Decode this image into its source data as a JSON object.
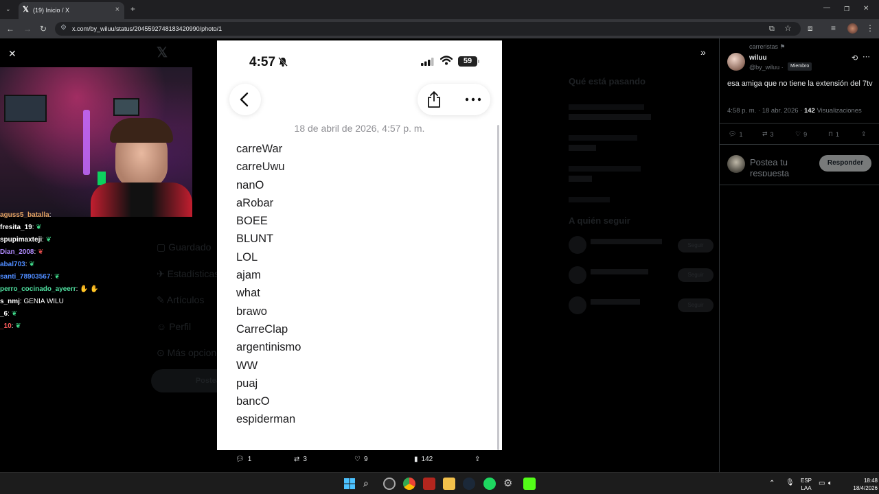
{
  "browser": {
    "tab_title": "(19) Inicio / X",
    "url": "x.com/by_wiluu/status/2045592748183420990/photo/1",
    "minimize": "—",
    "restore": "❐",
    "close": "✕"
  },
  "photo": {
    "status_time": "4:57",
    "battery": "59",
    "note_date": "18 de abril de 2026, 4:57 p. m.",
    "note_lines": [
      "carreWar",
      "carreUwu",
      "nanO",
      "aRobar",
      "BOEE",
      "BLUNT",
      "LOL",
      "ajam",
      "what",
      "brawo",
      "CarreClap",
      "argentinismo",
      "WW",
      "puaj",
      "bancO",
      "espiderman"
    ]
  },
  "viewer_actions": {
    "replies": "1",
    "reposts": "3",
    "likes": "9",
    "views": "142"
  },
  "tweet": {
    "community": "carreristas",
    "author_name": "wiluu",
    "author_handle": "@by_wiluu",
    "separator": "·",
    "member_badge": "Miembro",
    "text": "esa amiga que no tiene la extensión del 7tv",
    "time": "4:58 p. m.",
    "date": "18 abr. 2026",
    "views_count": "142",
    "views_label": "Visualizaciones",
    "stats": {
      "replies": "1",
      "reposts": "3",
      "likes": "9",
      "bookmarks": "1"
    },
    "reply_placeholder": "Postea tu respuesta",
    "reply_button": "Responder"
  },
  "chat": [
    {
      "user": "aguss5_batalla",
      "text": "",
      "color": "#e0a060"
    },
    {
      "user": "fresita_19",
      "text": "",
      "color": "#ffffff"
    },
    {
      "user": "spupimaxteji",
      "text": "",
      "color": "#ffffff"
    },
    {
      "user": "Dian_2008",
      "text": "",
      "color": "#b28cff"
    },
    {
      "user": "abal703",
      "text": "",
      "color": "#4f8cff"
    },
    {
      "user": "santi_78903567",
      "text": "",
      "color": "#4f8cff"
    },
    {
      "user": "perro_cocinado_ayeerr",
      "text": "",
      "color": "#4fe0a0"
    },
    {
      "user": "s_nmj",
      "text": "GENIA WILU",
      "color": "#ffffff"
    },
    {
      "user": "_6",
      "text": "",
      "color": "#ffffff"
    },
    {
      "user": "_10",
      "text": "",
      "color": "#ff5c5c"
    }
  ],
  "taskbar": {
    "language": "ESP",
    "layout": "LAA",
    "time": "18:48",
    "date": "18/4/2026"
  },
  "background_page": {
    "trends_title": "Qué está pasando",
    "follow_title": "A quién seguir",
    "nav_items": [
      "Guardado",
      "Estadísticas",
      "Artículos",
      "Perfil",
      "Más opciones"
    ],
    "post_button": "Postear",
    "follow_button": "Seguir"
  }
}
